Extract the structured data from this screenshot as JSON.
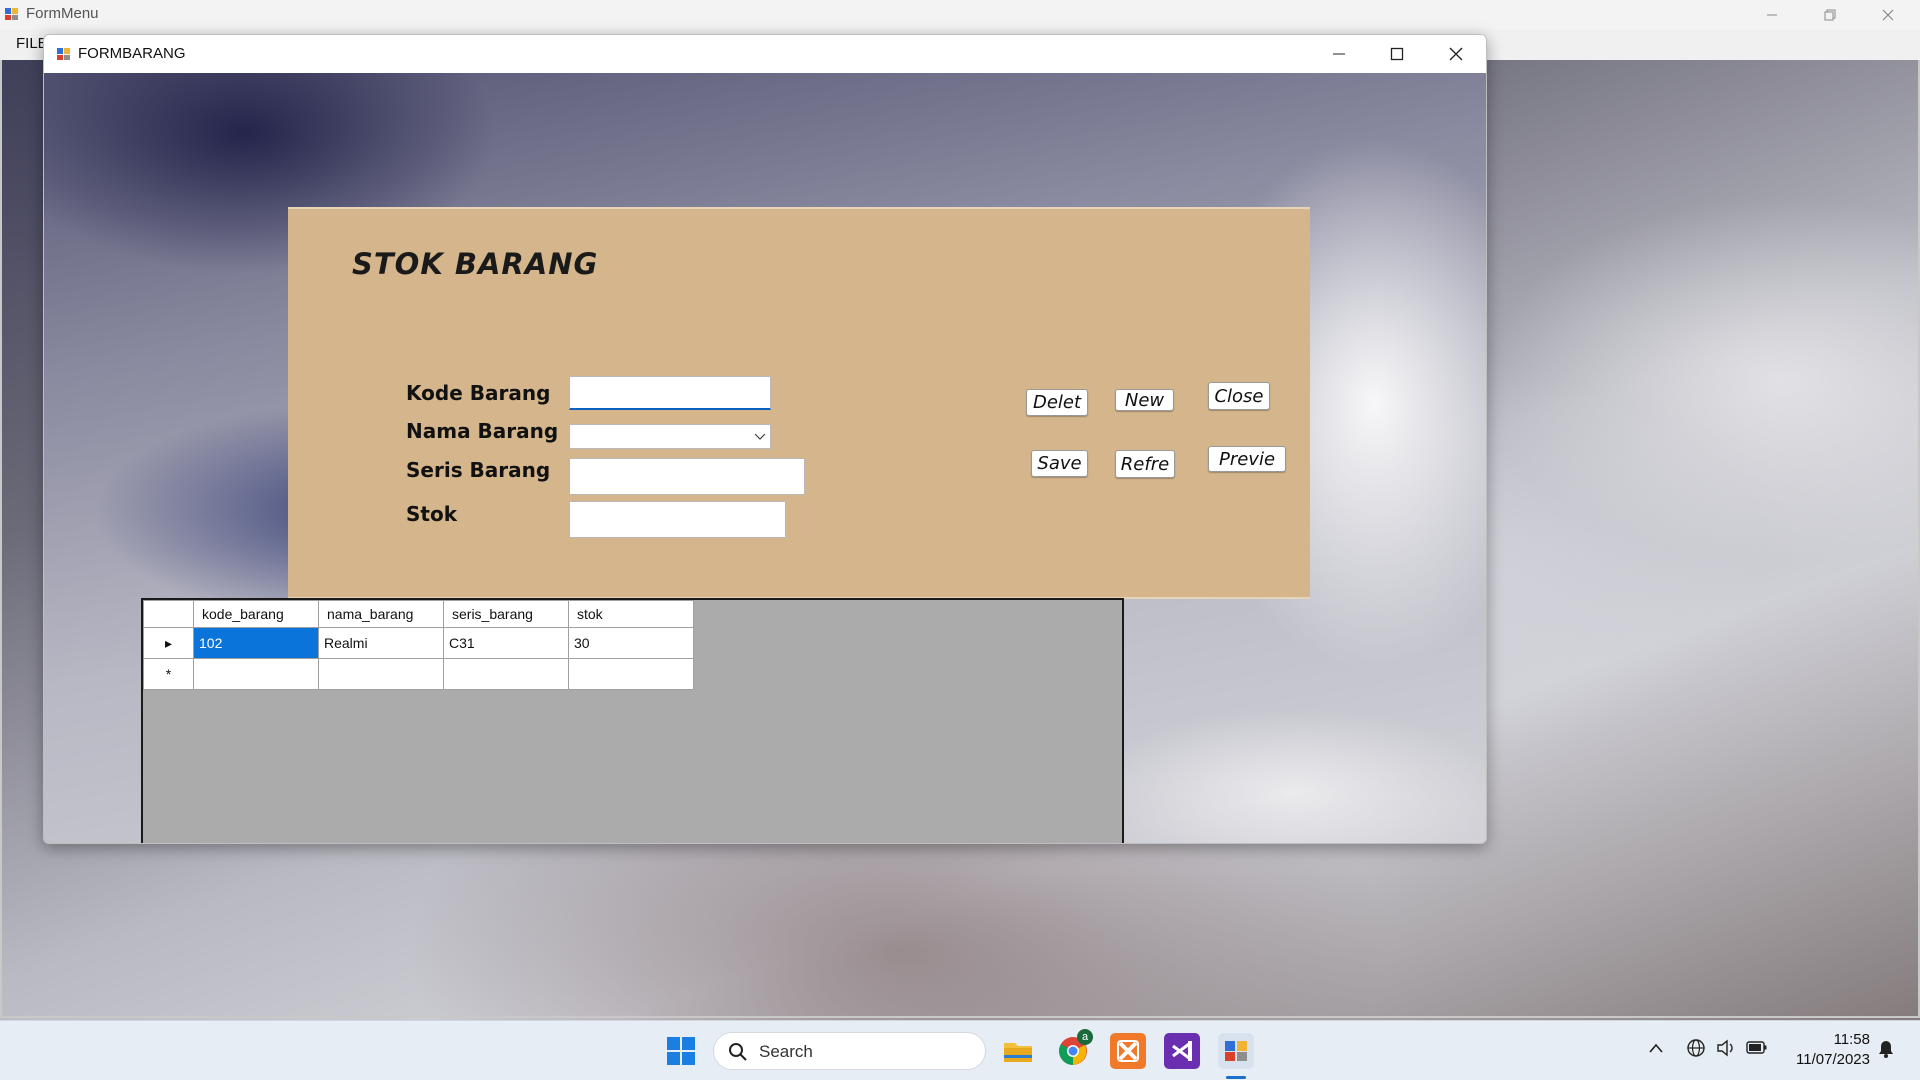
{
  "parent": {
    "title": "FormMenu",
    "menu": [
      "FILE"
    ]
  },
  "child": {
    "title": "FORMBARANG",
    "heading": "STOK BARANG",
    "fields": {
      "kode_label": "Kode Barang",
      "nama_label": "Nama Barang",
      "seris_label": "Seris Barang",
      "stok_label": "Stok",
      "kode_value": "",
      "nama_value": "",
      "seris_value": "",
      "stok_value": ""
    },
    "buttons": {
      "delete": "Delet",
      "new": "New",
      "close": "Close",
      "save": "Save",
      "refresh": "Refre",
      "preview": "Previe"
    },
    "grid": {
      "columns": [
        "kode_barang",
        "nama_barang",
        "seris_barang",
        "stok"
      ],
      "rows": [
        [
          "102",
          "Realmi",
          "C31",
          "30"
        ]
      ],
      "current_row_marker": "▸",
      "new_row_marker": "*"
    }
  },
  "taskbar": {
    "search_placeholder": "Search",
    "time": "11:58",
    "date": "11/07/2023",
    "chrome_badge": "a"
  },
  "colors": {
    "panel": "#d4b58c",
    "selection": "#0a74da",
    "grid_bg": "#ababab"
  }
}
